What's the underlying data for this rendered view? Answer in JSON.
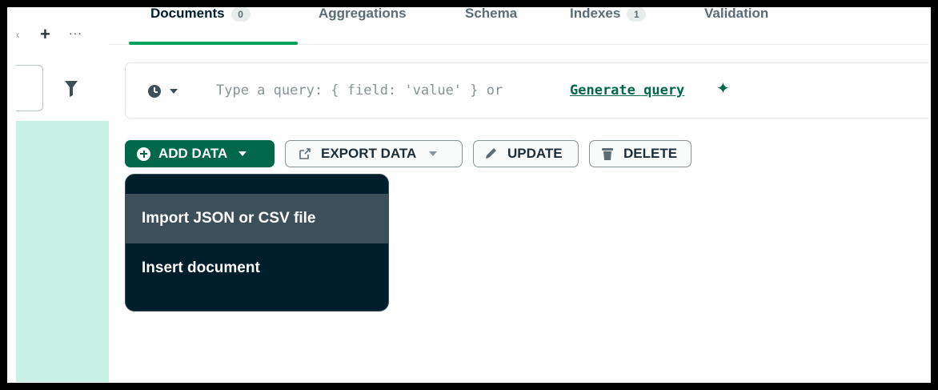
{
  "tabs": [
    {
      "label": "Documents",
      "count": "0",
      "active": true
    },
    {
      "label": "Aggregations"
    },
    {
      "label": "Schema"
    },
    {
      "label": "Indexes",
      "count": "1"
    },
    {
      "label": "Validation"
    }
  ],
  "sidebar": {
    "plus_icon": "+",
    "more_icon": "···",
    "chevron_icon": "‹"
  },
  "query": {
    "placeholder": "Type a query: { field: 'value' } or",
    "generate_label": "Generate query",
    "history_icon": "clock-icon",
    "sparkle_icon": "✦"
  },
  "toolbar": {
    "add_label": "ADD DATA",
    "export_label": "EXPORT DATA",
    "update_label": "UPDATE",
    "delete_label": "DELETE"
  },
  "menu": {
    "items": [
      {
        "label": "Import JSON or CSV file"
      },
      {
        "label": "Insert document"
      }
    ]
  },
  "colors": {
    "accent_green": "#00684a",
    "tab_underline": "#00a35c",
    "menu_bg": "#001e2b",
    "menu_hover": "#3d4f58",
    "sidebar_green": "#c9f0e5"
  }
}
